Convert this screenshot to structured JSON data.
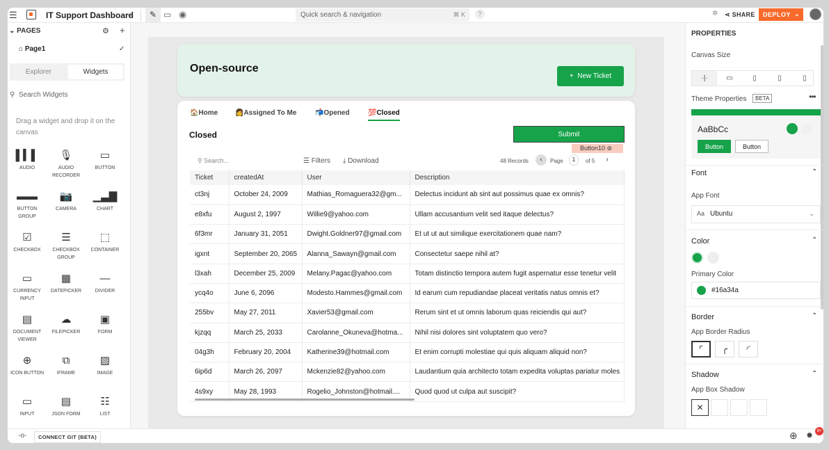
{
  "topbar": {
    "app_title": "IT Support Dashboard",
    "search_placeholder": "Quick search & navigation",
    "search_shortcut": "⌘ K",
    "help": "?",
    "share": "SHARE",
    "deploy": "DEPLOY"
  },
  "sidebar": {
    "pages_label": "PAGES",
    "page_name": "Page1",
    "tabs": [
      "Explorer",
      "Widgets"
    ],
    "search_placeholder": "Search Widgets",
    "hint": "Drag a widget and drop it on the canvas",
    "widgets": [
      {
        "label": "AUDIO",
        "icon": "audio-icon"
      },
      {
        "label": "AUDIO RECORDER",
        "icon": "microphone-icon"
      },
      {
        "label": "BUTTON",
        "icon": "button-icon"
      },
      {
        "label": "BUTTON GROUP",
        "icon": "button-group-icon"
      },
      {
        "label": "CAMERA",
        "icon": "camera-icon"
      },
      {
        "label": "CHART",
        "icon": "chart-icon"
      },
      {
        "label": "CHECKBOX",
        "icon": "checkbox-icon"
      },
      {
        "label": "CHECKBOX GROUP",
        "icon": "checkbox-group-icon"
      },
      {
        "label": "CONTAINER",
        "icon": "container-icon"
      },
      {
        "label": "CURRENCY INPUT",
        "icon": "currency-input-icon"
      },
      {
        "label": "DATEPICKER",
        "icon": "calendar-icon"
      },
      {
        "label": "DIVIDER",
        "icon": "divider-icon"
      },
      {
        "label": "DOCUMENT VIEWER",
        "icon": "document-icon"
      },
      {
        "label": "FILEPICKER",
        "icon": "cloud-upload-icon"
      },
      {
        "label": "FORM",
        "icon": "form-icon"
      },
      {
        "label": "ICON BUTTON",
        "icon": "plus-circle-icon"
      },
      {
        "label": "IFRAME",
        "icon": "iframe-icon"
      },
      {
        "label": "IMAGE",
        "icon": "image-icon"
      },
      {
        "label": "INPUT",
        "icon": "input-icon"
      },
      {
        "label": "JSON FORM",
        "icon": "json-form-icon"
      },
      {
        "label": "LIST",
        "icon": "list-icon"
      }
    ],
    "git_label": "CONNECT GIT (BETA)",
    "notification_count": "9+"
  },
  "canvas": {
    "header_title": "Open-source",
    "new_ticket_label": "New Ticket",
    "tabs": [
      {
        "icon": "🏠",
        "label": "Home"
      },
      {
        "icon": "👩",
        "label": "Assigned To Me"
      },
      {
        "icon": "📬",
        "label": "Opened"
      },
      {
        "icon": "💯",
        "label": "Closed"
      }
    ],
    "section_title": "Closed",
    "submit_label": "Submit",
    "selected_widget_label": "Button10",
    "table": {
      "search_placeholder": "Search...",
      "filters_label": "Filters",
      "download_label": "Download",
      "records": "48 Records",
      "page_label": "Page",
      "page_num": "1",
      "page_of": "of 5",
      "columns": [
        "Ticket",
        "createdAt",
        "User",
        "Description"
      ],
      "rows": [
        [
          "ct3nj",
          "October 24, 2009",
          "Mathias_Romaguera32@gm...",
          "Delectus incidunt ab sint aut possimus quae ex omnis?"
        ],
        [
          "e8xfu",
          "August 2, 1997",
          "Willie9@yahoo.com",
          "Ullam accusantium velit sed itaque delectus?"
        ],
        [
          "6f3mr",
          "January 31, 2051",
          "Dwight.Goldner97@gmail.com",
          "Et ut ut aut similique exercitationem quae nam?"
        ],
        [
          "igxnt",
          "September 20, 2065",
          "Alanna_Sawayn@gmail.com",
          "Consectetur saepe nihil at?"
        ],
        [
          "l3xah",
          "December 25, 2009",
          "Melany.Pagac@yahoo.com",
          "Totam distinctio tempora autem fugit aspernatur esse tenetur velit"
        ],
        [
          "ycq4o",
          "June 6, 2096",
          "Modesto.Hammes@gmail.com",
          "Id earum cum repudiandae placeat veritatis natus omnis et?"
        ],
        [
          "255bv",
          "May 27, 2011",
          "Xavier53@gmail.com",
          "Rerum sint et ut omnis laborum quas reiciendis qui aut?"
        ],
        [
          "kjzqq",
          "March 25, 2033",
          "Carolanne_Okuneva@hotma...",
          "Nihil nisi dolores sint voluptatem quo vero?"
        ],
        [
          "04g3h",
          "February 20, 2004",
          "Katherine39@hotmail.com",
          "Et enim corrupti molestiae qui quis aliquam aliquid non?"
        ],
        [
          "6ip6d",
          "March 26, 2097",
          "Mckenzie82@yahoo.com",
          "Laudantium quia architecto totam expedita voluptas pariatur moles"
        ],
        [
          "4s9xy",
          "May 28, 1993",
          "Rogelio_Johnston@hotmail....",
          "Quod quod ut culpa aut suscipit?"
        ]
      ]
    }
  },
  "properties": {
    "title": "PROPERTIES",
    "canvas_size_label": "Canvas Size",
    "theme_label": "Theme Properties",
    "beta": "BETA",
    "theme_sample": "AaBbCc",
    "theme_btn_primary": "Button",
    "theme_btn_secondary": "Button",
    "font_section": "Font",
    "app_font_label": "App Font",
    "font_aa": "Aa",
    "font_value": "Ubuntu",
    "color_section": "Color",
    "primary_color_label": "Primary Color",
    "primary_color_value": "#16a34a",
    "border_section": "Border",
    "border_radius_label": "App Border Radius",
    "shadow_section": "Shadow",
    "shadow_label": "App Box Shadow"
  },
  "colors": {
    "accent": "#16a34a",
    "deploy": "#f86a2b",
    "header_bg": "#e3f3ea"
  }
}
